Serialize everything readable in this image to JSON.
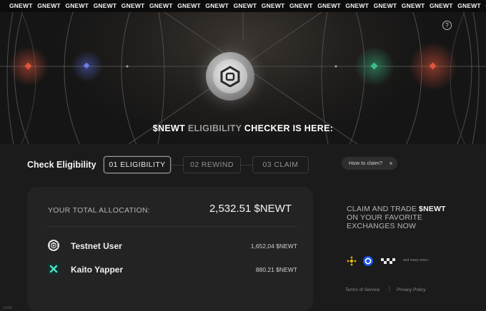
{
  "ticker": [
    "GNEWT",
    "GNEWT",
    "GNEWT",
    "GNEWT",
    "GNEWT",
    "GNEWT",
    "GNEWT",
    "GNEWT",
    "GNEWT",
    "GNEWT",
    "GNEWT",
    "GNEWT",
    "GNEWT",
    "GNEWT",
    "GNEWT",
    "GNEWT",
    "GNEWT",
    "GNEWT"
  ],
  "hero": {
    "title_part1": "$NEWT",
    "title_part2": "ELIGIBILITY",
    "title_part3": "CHECKER IS HERE:",
    "help_icon": "question-circle-icon",
    "logo_icon": "newt-hexagon-logo"
  },
  "check": {
    "title": "Check Eligibility",
    "steps": [
      {
        "label": "01 ELIGIBILITY",
        "active": true
      },
      {
        "label": "02 REWIND",
        "active": false
      },
      {
        "label": "03 CLAIM",
        "active": false
      }
    ],
    "how_to": "How to claim?"
  },
  "allocation": {
    "label": "YOUR TOTAL ALLOCATION:",
    "value": "2,532.51 $NEWT",
    "rows": [
      {
        "label": "Testnet User",
        "value": "1,652,04 $NEWT",
        "icon": "newt-logo-icon"
      },
      {
        "label": "Kaito Yapper",
        "value": "880.21 $NEWT",
        "icon": "kaito-icon"
      }
    ]
  },
  "claim": {
    "line1_prefix": "CLAIM AND TRADE",
    "line1_token": "$NEWT",
    "line2": "ON YOUR FAVORITE",
    "line3": "EXCHANGES NOW",
    "exchanges": [
      "binance-icon",
      "coinbase-icon",
      "okx-icon"
    ],
    "many_more": "and many more.."
  },
  "footer": {
    "terms": "Terms of Service",
    "separator": "|",
    "privacy": "Privacy Policy"
  },
  "corner_text": "EAAE",
  "colors": {
    "accent_red": "#e0553b",
    "accent_green": "#3bbf86",
    "accent_blue": "#5a6bd8",
    "binance_yellow": "#f0b90b",
    "coinbase_blue": "#1652f0",
    "kaito_teal": "#4fe0c6"
  }
}
